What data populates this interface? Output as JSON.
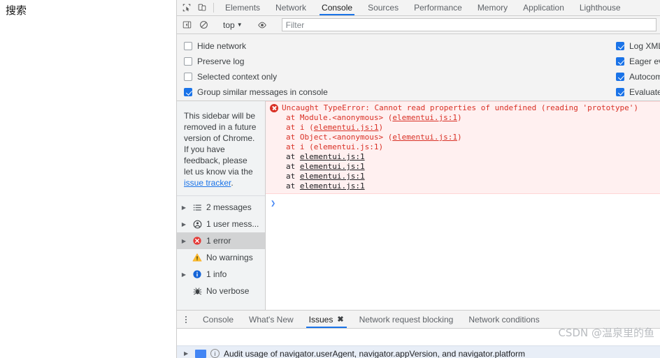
{
  "page": {
    "left_search_label": "搜索"
  },
  "devtools": {
    "toolbar_icons": [
      {
        "name": "inspect-element-icon",
        "glyph": "inspect"
      },
      {
        "name": "device-toolbar-icon",
        "glyph": "device"
      }
    ],
    "tabs": [
      {
        "label": "Elements",
        "active": false
      },
      {
        "label": "Network",
        "active": false
      },
      {
        "label": "Console",
        "active": true
      },
      {
        "label": "Sources",
        "active": false
      },
      {
        "label": "Performance",
        "active": false
      },
      {
        "label": "Memory",
        "active": false
      },
      {
        "label": "Application",
        "active": false
      },
      {
        "label": "Lighthouse",
        "active": false
      }
    ],
    "filterbar": {
      "sidebar_toggle_icon": "sidebar-toggle-icon",
      "clear_console_icon": "clear-console-icon",
      "context_selector": "top",
      "caret": "▼",
      "levels_icon": "eye-icon",
      "filter_placeholder": "Filter",
      "filter_value": ""
    },
    "settings": {
      "left_column": [
        {
          "label": "Hide network",
          "checked": false
        },
        {
          "label": "Preserve log",
          "checked": false
        },
        {
          "label": "Selected context only",
          "checked": false
        },
        {
          "label": "Group similar messages in console",
          "checked": true
        }
      ],
      "right_column": [
        {
          "label": "Log XML",
          "checked": true
        },
        {
          "label": "Eager ev",
          "checked": true
        },
        {
          "label": "Autocom",
          "checked": true
        },
        {
          "label": "Evaluate",
          "checked": true
        }
      ]
    },
    "sidebar": {
      "notice_text_1": "This sidebar will be removed in a future version of Chrome. If you have feedback, please let us know via the ",
      "notice_link": "issue tracker",
      "notice_text_2": ".",
      "items": [
        {
          "label": "2 messages",
          "icon": "list-icon",
          "expandable": true,
          "selected": false
        },
        {
          "label": "1 user mess...",
          "icon": "user-icon",
          "expandable": true,
          "selected": false
        },
        {
          "label": "1 error",
          "icon": "error-icon",
          "expandable": true,
          "selected": true
        },
        {
          "label": "No warnings",
          "icon": "warning-icon",
          "expandable": false,
          "selected": false
        },
        {
          "label": "1 info",
          "icon": "info-icon",
          "expandable": true,
          "selected": false
        },
        {
          "label": "No verbose",
          "icon": "verbose-icon",
          "expandable": false,
          "selected": false
        }
      ]
    },
    "console": {
      "error_headline": "Uncaught TypeError: Cannot read properties of undefined (reading 'prototype')",
      "stack": [
        {
          "prefix": "at Module.<anonymous> (",
          "link": "elementui.js:1",
          "suffix": ")",
          "color": "red"
        },
        {
          "prefix": "at i (",
          "link": "elementui.js:1",
          "suffix": ")",
          "color": "red"
        },
        {
          "prefix": "at Object.<anonymous> (",
          "link": "elementui.js:1",
          "suffix": ")",
          "color": "red"
        },
        {
          "prefix": "at i (",
          "link": "elementui.js:1",
          "suffix": ")",
          "color": "red"
        },
        {
          "prefix": "at ",
          "link": "elementui.js:1",
          "suffix": "",
          "color": "dark"
        },
        {
          "prefix": "at ",
          "link": "elementui.js:1",
          "suffix": "",
          "color": "dark"
        },
        {
          "prefix": "at ",
          "link": "elementui.js:1",
          "suffix": "",
          "color": "dark"
        },
        {
          "prefix": "at ",
          "link": "elementui.js:1",
          "suffix": "",
          "color": "dark"
        }
      ],
      "prompt_caret": "❯"
    },
    "drawer": {
      "tabs": [
        {
          "label": "Console",
          "active": false,
          "closable": false
        },
        {
          "label": "What's New",
          "active": false,
          "closable": false
        },
        {
          "label": "Issues",
          "active": true,
          "closable": true,
          "close_glyph": "✖"
        },
        {
          "label": "Network request blocking",
          "active": false,
          "closable": false
        },
        {
          "label": "Network conditions",
          "active": false,
          "closable": false
        }
      ],
      "issue_row": {
        "arrow": "▶",
        "count_badge": "",
        "severity": "i",
        "text": "Audit usage of navigator.userAgent, navigator.appVersion, and navigator.platform"
      }
    }
  },
  "watermark": "CSDN @温泉里的鱼",
  "colors": {
    "accent_blue": "#1a73e8",
    "error_red": "#d93025",
    "error_bg": "#fff0f0",
    "toolbar_bg": "#f3f3f3",
    "sidebar_bg": "#f1f3f4",
    "warning_yellow": "#fbbc04",
    "info_blue": "#1a73e8"
  }
}
